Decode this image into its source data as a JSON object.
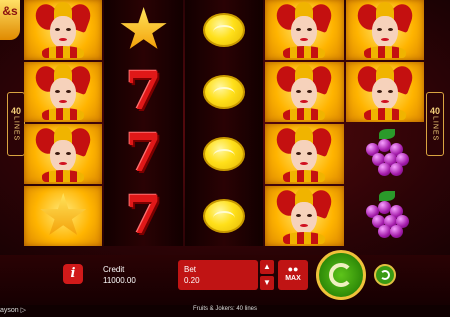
{
  "logo_text": "&s",
  "paylines": {
    "count": "40",
    "word": "LINES"
  },
  "reels": [
    [
      "joker",
      "joker",
      "joker",
      "star"
    ],
    [
      "star",
      "seven",
      "seven",
      "seven"
    ],
    [
      "lemon",
      "lemon",
      "lemon",
      "lemon"
    ],
    [
      "joker",
      "joker",
      "joker",
      "joker"
    ],
    [
      "joker",
      "joker",
      "grapes",
      "grapes"
    ]
  ],
  "controls": {
    "info_label": "i",
    "credit_label": "Credit",
    "credit_value": "11000.00",
    "bet_label": "Bet",
    "bet_value": "0.20",
    "step_up": "▲",
    "step_down": "▼",
    "max_label": "MAX",
    "max_coins": "●●"
  },
  "footer": {
    "brand": "ayson ▷",
    "game_title": "Fruits & Jokers: 40 lines"
  },
  "colors": {
    "accent_red": "#c01414",
    "spin_green": "#2e8a08",
    "gold": "#f0c23a"
  }
}
